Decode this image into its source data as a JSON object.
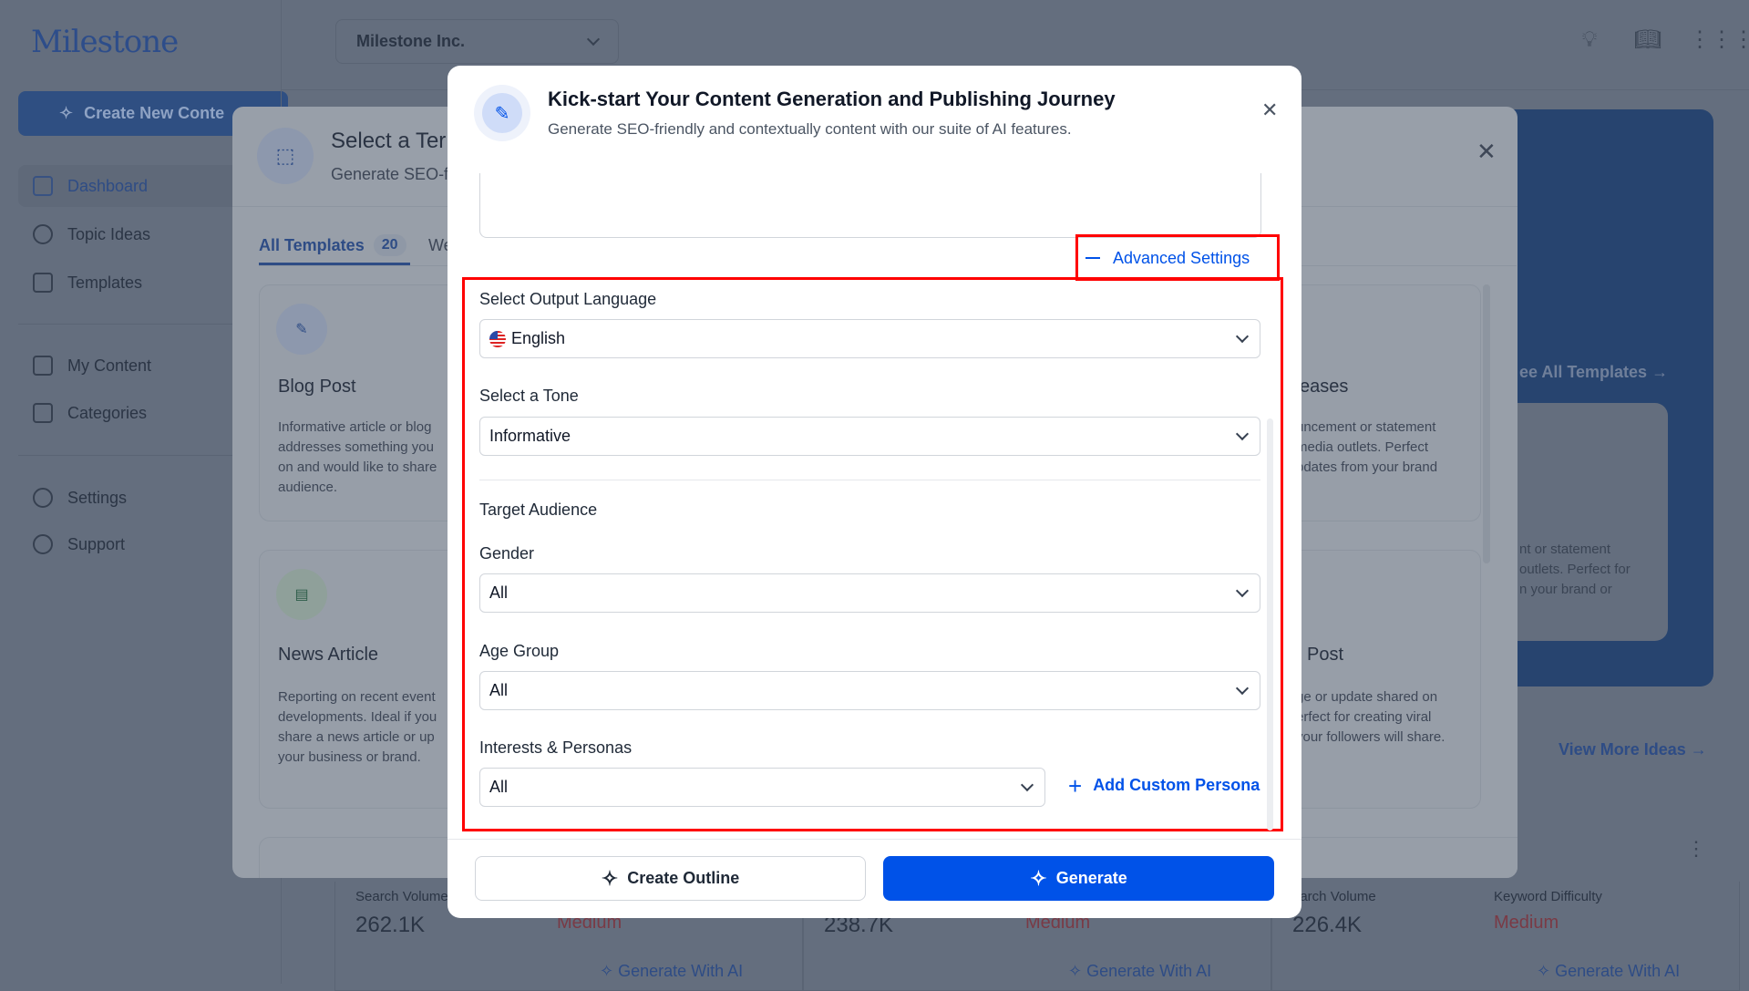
{
  "sidebar": {
    "logo": "Milestone",
    "create_button": "Create New Conte",
    "items": [
      {
        "label": "Dashboard",
        "active": true
      },
      {
        "label": "Topic Ideas"
      },
      {
        "label": "Templates"
      },
      {
        "label": "My Content"
      },
      {
        "label": "Categories"
      },
      {
        "label": "Settings"
      },
      {
        "label": "Support"
      }
    ]
  },
  "topbar": {
    "org": "Milestone Inc.",
    "icons": [
      "lightbulb-icon",
      "book-icon",
      "apps-grid-icon"
    ]
  },
  "background": {
    "see_all_templates": "ee All Templates",
    "panel_card_text": [
      "nt or statement",
      "outlets. Perfect for",
      "n your brand or"
    ],
    "view_more_ideas": "View More Ideas",
    "keyword_cards": [
      {
        "search_label": "Search Volume",
        "search_value": "262.1K",
        "difficulty_value": "Medium",
        "action": "Generate With AI"
      },
      {
        "search_value": "238.7K",
        "difficulty_value": "Medium",
        "action": "Generate With AI"
      },
      {
        "search_label": "earch Volume",
        "search_value": "226.4K",
        "difficulty_label": "Keyword Difficulty",
        "difficulty_value": "Medium",
        "action": "Generate With AI"
      }
    ]
  },
  "template_modal": {
    "title": "Select a Ter",
    "subtitle": "Generate SEO-f",
    "tabs": [
      {
        "label": "All Templates",
        "count": "20",
        "active": true
      },
      {
        "label": "We"
      }
    ],
    "cards": [
      {
        "title": "Blog Post",
        "desc": [
          "Informative article or blog",
          "addresses something you",
          "on and would like to share",
          "audience."
        ]
      },
      {
        "title": "News Article",
        "desc": [
          "Reporting on recent event",
          "developments. Ideal if you",
          "share a news article or up",
          "your business or brand."
        ]
      },
      {
        "title": "eases",
        "desc": [
          "uncement or statement",
          "media outlets. Perfect",
          "pdates from your brand"
        ]
      },
      {
        "title": "Post",
        "desc": [
          "ge or update shared on",
          "erfect for creating viral",
          "your followers will share."
        ]
      }
    ]
  },
  "modal": {
    "title": "Kick-start Your Content Generation and Publishing Journey",
    "subtitle": "Generate SEO-friendly and contextually content with our suite of AI features.",
    "advanced_settings": "Advanced Settings",
    "language_label": "Select Output Language",
    "language_value": "English",
    "tone_label": "Select a Tone",
    "tone_value": "Informative",
    "audience_heading": "Target Audience",
    "gender_label": "Gender",
    "gender_value": "All",
    "age_label": "Age Group",
    "age_value": "All",
    "interests_label": "Interests & Personas",
    "interests_value": "All",
    "add_persona": "Add Custom Persona",
    "create_outline": "Create Outline",
    "generate": "Generate"
  },
  "colors": {
    "primary": "#0052e8",
    "highlight": "#ff0000",
    "overlay": "#646e7e"
  }
}
